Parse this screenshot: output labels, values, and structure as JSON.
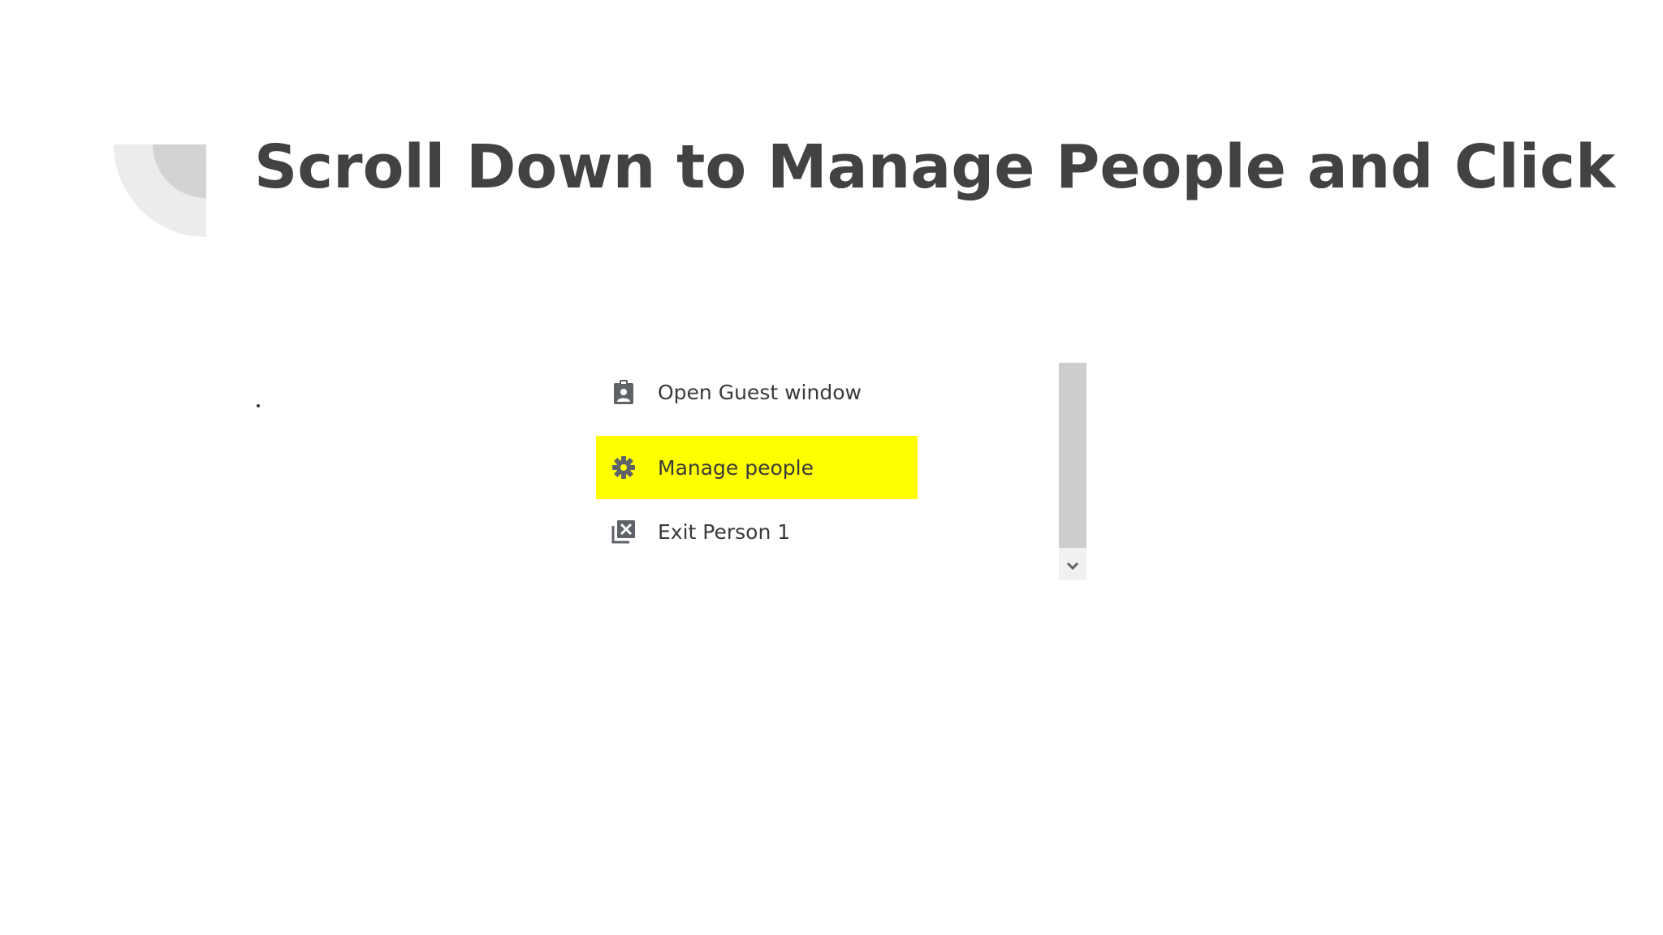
{
  "slide": {
    "title": "Scroll Down to Manage People and Click"
  },
  "menu": {
    "items": [
      {
        "label": "Open Guest window",
        "icon": "guest-badge-icon"
      },
      {
        "label": "Manage people",
        "icon": "gear-icon",
        "highlighted": true
      },
      {
        "label": "Exit Person 1",
        "icon": "exit-window-icon"
      }
    ]
  },
  "colors": {
    "highlight": "#ffff00",
    "title": "#424242",
    "icon": "#5f6368",
    "scrollbar_thumb": "#cdcdcd"
  }
}
